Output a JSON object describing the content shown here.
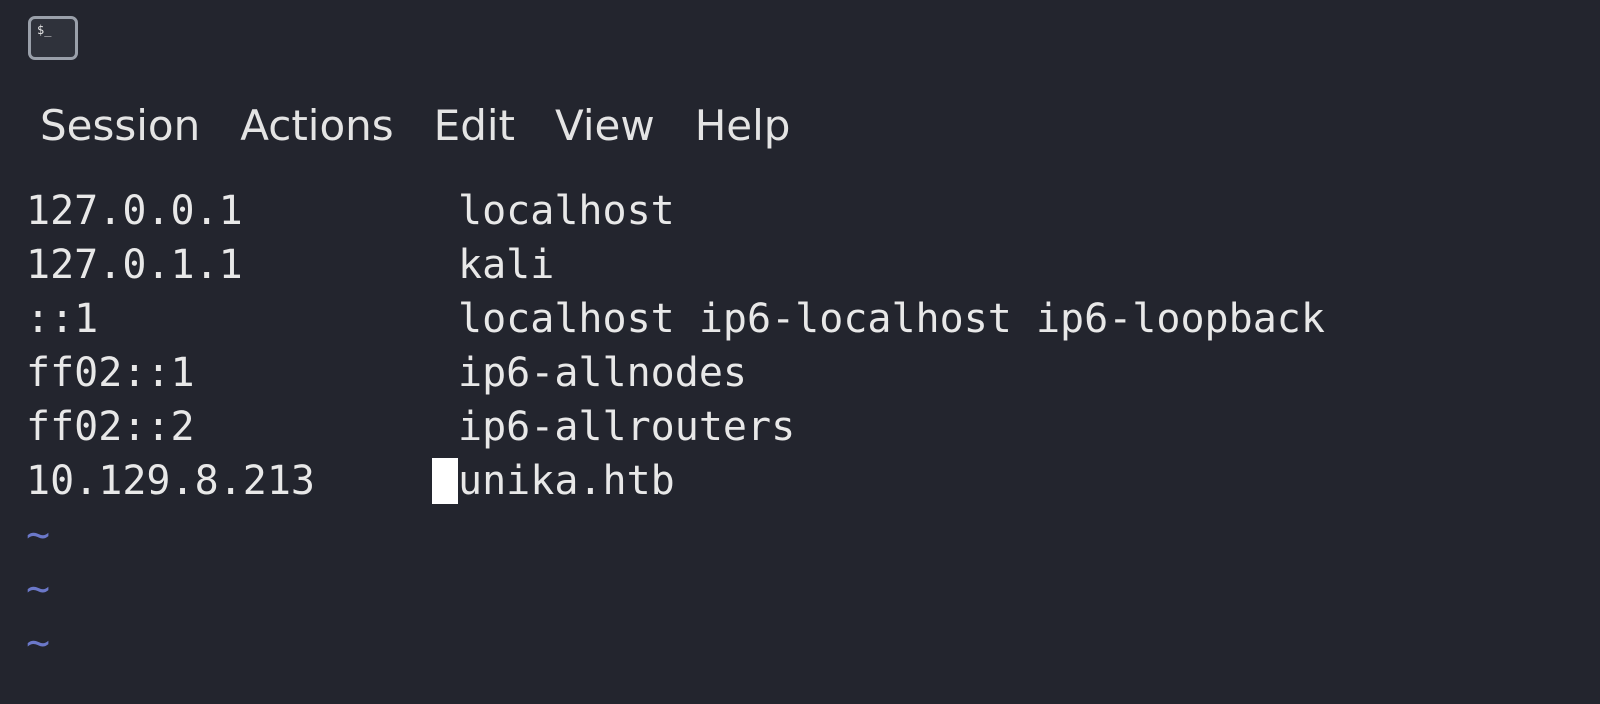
{
  "window": {
    "icon": "terminal-icon",
    "icon_glyph": "$_"
  },
  "menu": {
    "items": [
      "Session",
      "Actions",
      "Edit",
      "View",
      "Help"
    ]
  },
  "editor": {
    "lines": [
      {
        "ip": "127.0.0.1",
        "hosts": "localhost"
      },
      {
        "ip": "127.0.1.1",
        "hosts": "kali"
      },
      {
        "ip": "::1",
        "hosts": "localhost ip6-localhost ip6-loopback"
      },
      {
        "ip": "ff02::1",
        "hosts": "ip6-allnodes"
      },
      {
        "ip": "ff02::2",
        "hosts": "ip6-allrouters"
      },
      {
        "ip": "10.129.8.213",
        "hosts": "unika.htb"
      }
    ],
    "empty_marker": "~",
    "empty_lines": 3,
    "cursor_line": 6
  },
  "colors": {
    "background": "#23252e",
    "text": "#e8e8e8",
    "tilde": "#6b78c9",
    "cursor": "#ffffff"
  }
}
